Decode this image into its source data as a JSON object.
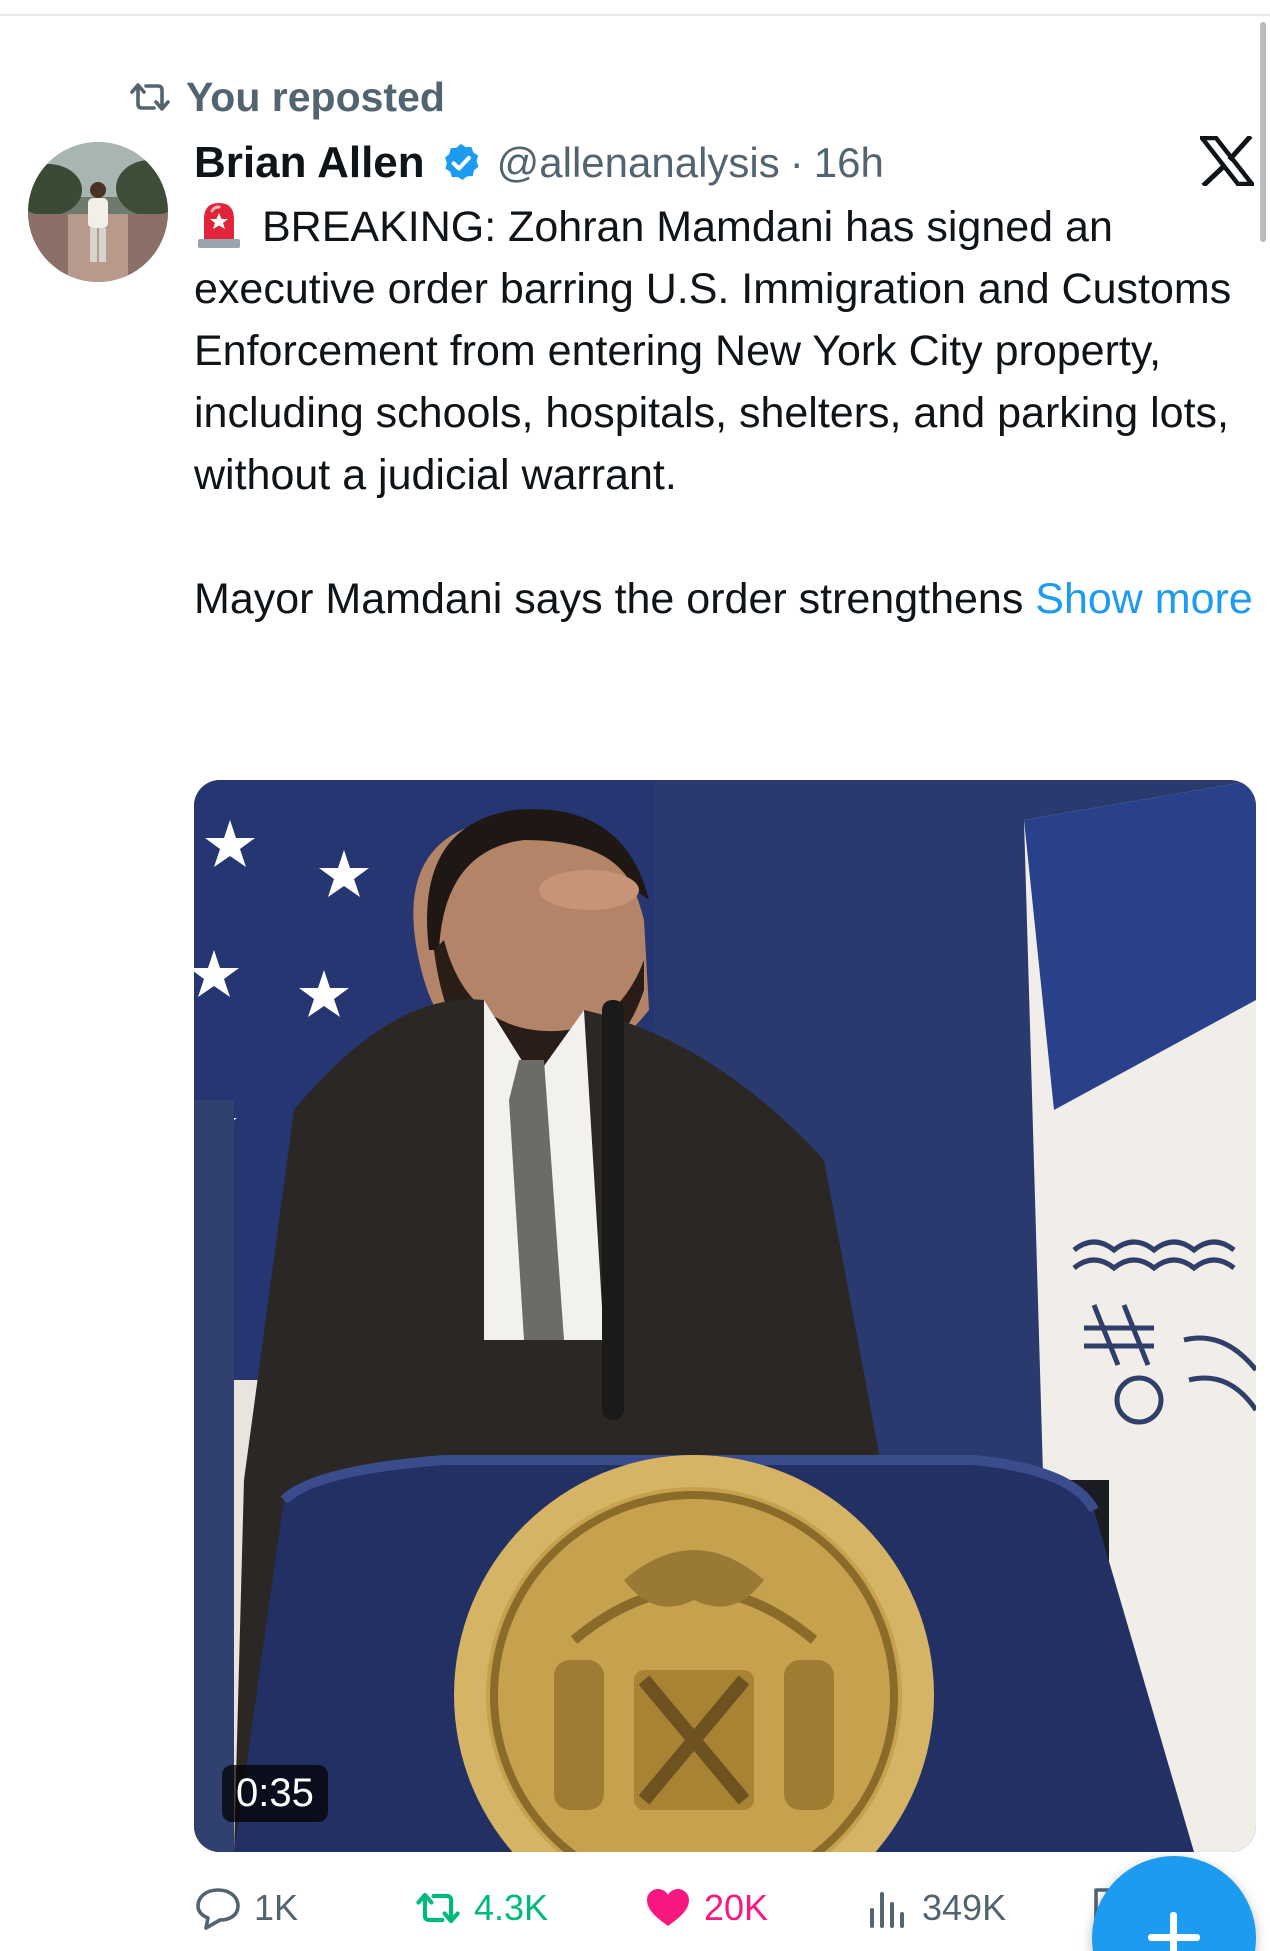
{
  "repost_banner": {
    "label": "You reposted"
  },
  "post": {
    "author_name": "Brian Allen",
    "author_handle": "@allenanalysis",
    "separator": "·",
    "time": "16h",
    "text_paragraph_1": "BREAKING: Zohran Mamdani has signed an executive order barring U.S. Immigration and Customs Enforcement from entering New York City property, including schools, hospitals, shelters, and parking lots, without a judicial warrant.",
    "text_paragraph_2": "Mayor Mamdani says the order strengthens",
    "show_more_label": "Show more",
    "media": {
      "type": "video",
      "duration": "0:35"
    }
  },
  "actions": {
    "replies": "1K",
    "reposts": "4.3K",
    "likes": "20K",
    "views": "349K"
  },
  "icons": {
    "repost_banner": "repost-icon",
    "verified": "verified-badge-icon",
    "brand": "x-logo-icon",
    "emoji": "police-light-emoji",
    "reply": "reply-icon",
    "repost": "repost-icon",
    "like": "heart-icon",
    "views": "views-chart-icon",
    "bookmark": "bookmark-icon",
    "compose": "plus-icon"
  },
  "colors": {
    "accent": "#1d9bf0",
    "repost_active": "#00ba7c",
    "like_active": "#f91880",
    "secondary_text": "#536471",
    "primary_text": "#0f1419"
  }
}
